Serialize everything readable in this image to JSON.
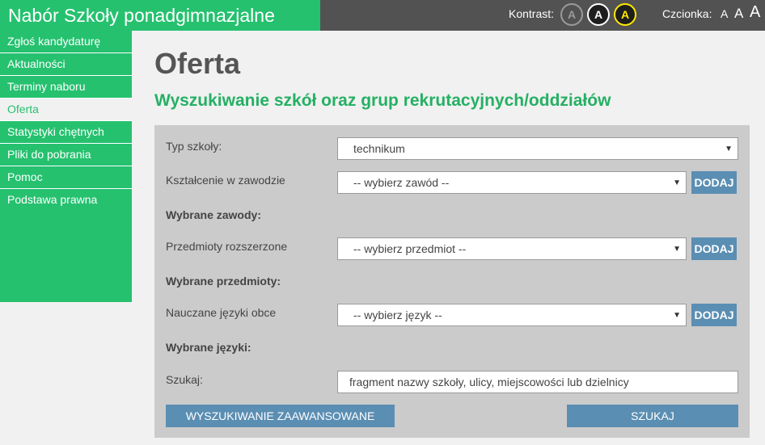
{
  "header": {
    "title": "Nabór Szkoły ponadgimnazjalne",
    "contrast_label": "Kontrast:",
    "contrast_options": [
      "A",
      "A",
      "A"
    ],
    "font_label": "Czcionka:",
    "font_sizes": [
      "A",
      "A",
      "A"
    ]
  },
  "sidebar": {
    "items": [
      {
        "label": "Zgłoś kandydaturę"
      },
      {
        "label": "Aktualności"
      },
      {
        "label": "Terminy naboru"
      },
      {
        "label": "Oferta"
      },
      {
        "label": "Statystyki chętnych"
      },
      {
        "label": "Pliki do pobrania"
      },
      {
        "label": "Pomoc"
      },
      {
        "label": "Podstawa prawna"
      }
    ],
    "active_index": 3
  },
  "main": {
    "page_title": "Oferta",
    "section_title": "Wyszukiwanie szkół oraz grup rekrutacyjnych/oddziałów"
  },
  "form": {
    "school_type": {
      "label": "Typ szkoły:",
      "value": "technikum"
    },
    "profession": {
      "label": "Kształcenie w zawodzie",
      "value": "-- wybierz zawód --",
      "add_label": "DODAJ"
    },
    "selected_professions_label": "Wybrane zawody:",
    "subjects": {
      "label": "Przedmioty rozszerzone",
      "value": "-- wybierz przedmiot --",
      "add_label": "DODAJ"
    },
    "selected_subjects_label": "Wybrane przedmioty:",
    "languages": {
      "label": "Nauczane języki obce",
      "value": "-- wybierz język --",
      "add_label": "DODAJ"
    },
    "selected_languages_label": "Wybrane języki:",
    "search": {
      "label": "Szukaj:",
      "placeholder": "fragment nazwy szkoły, ulicy, miejscowości lub dzielnicy"
    },
    "advanced_label": "WYSZUKIWANIE ZAAWANSOWANE",
    "submit_label": "SZUKAJ"
  },
  "colors": {
    "accent": "#25c16f",
    "header_dark": "#525252",
    "button": "#5b8eb3",
    "panel": "#cbcbcb"
  },
  "icons": {
    "select_arrow": "chevron-down-icon"
  }
}
